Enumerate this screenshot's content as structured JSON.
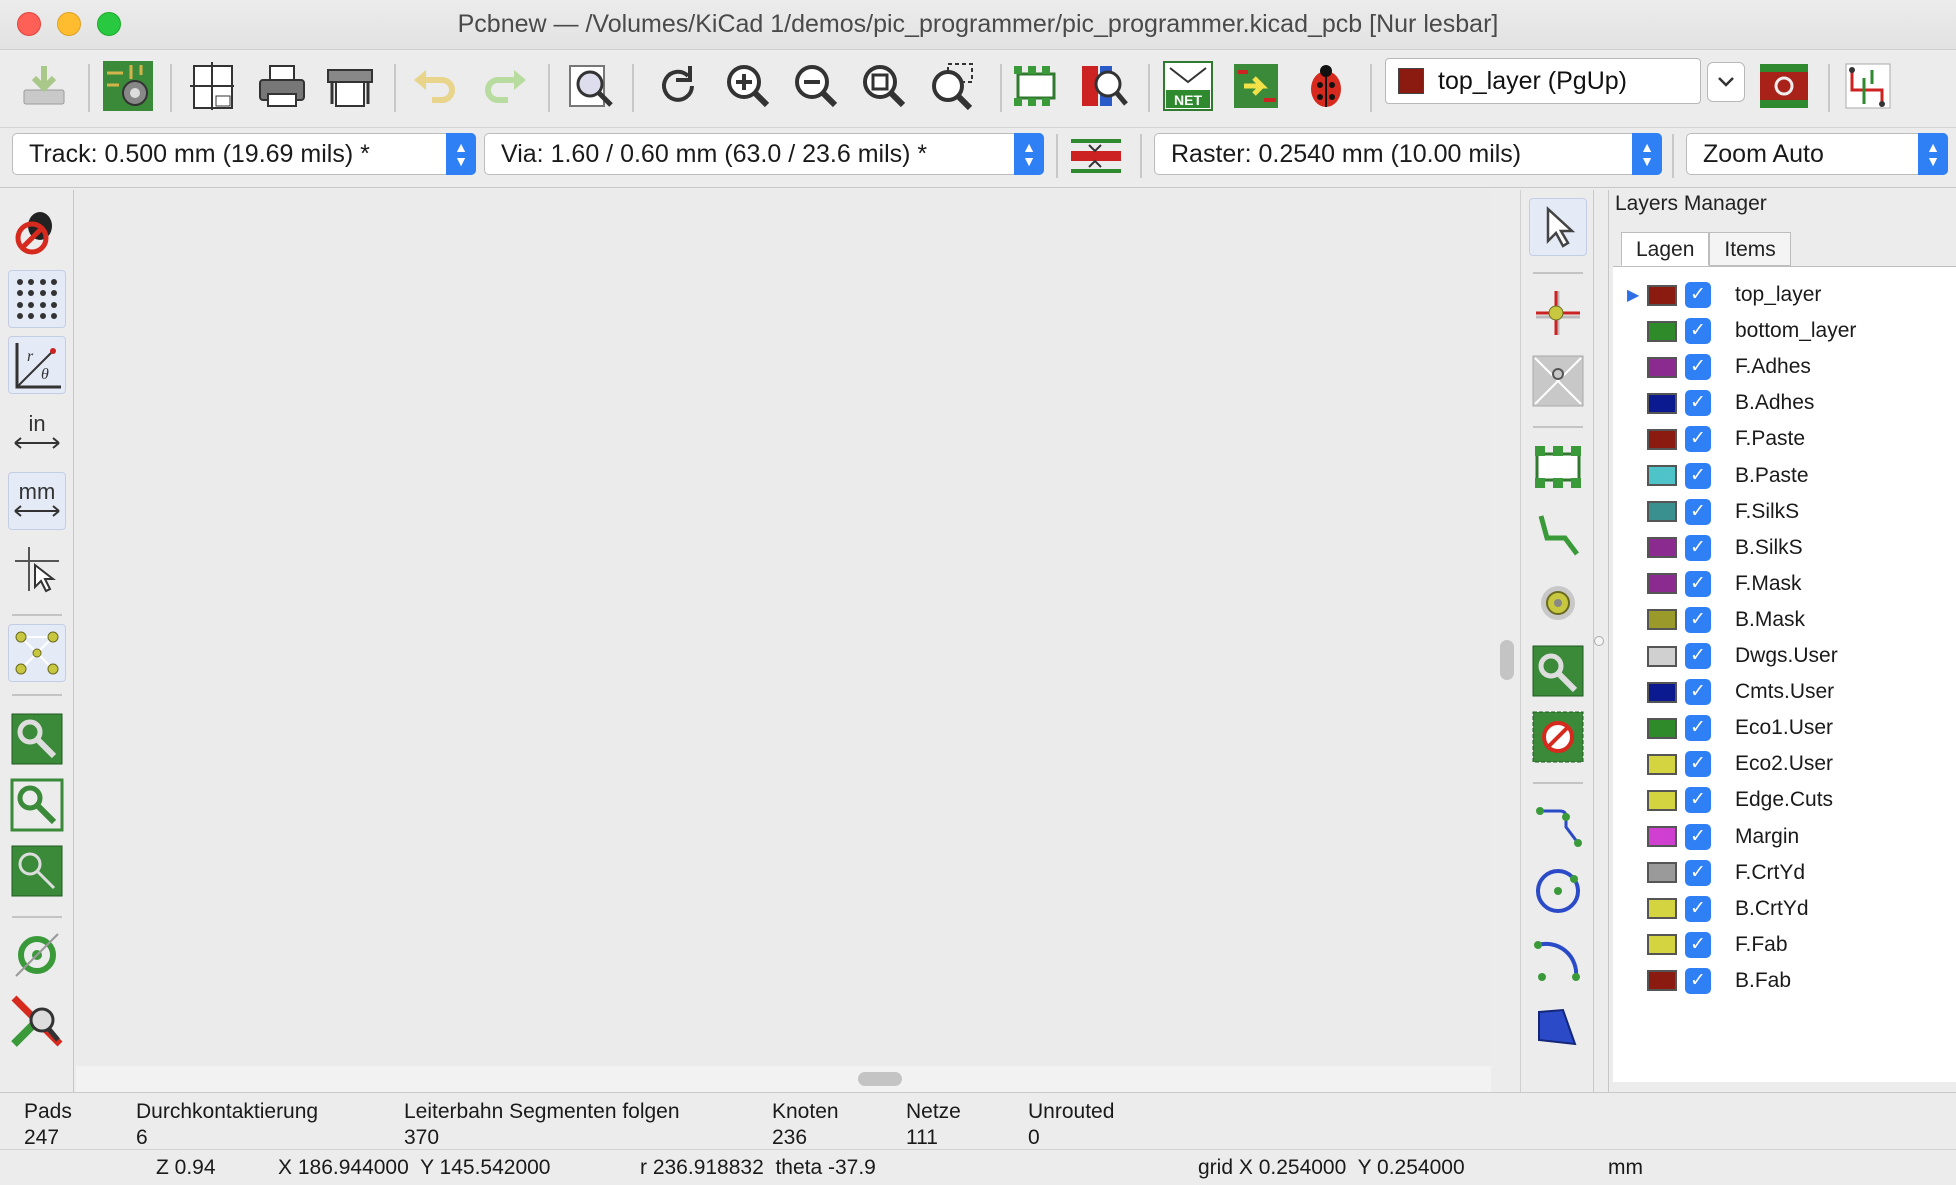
{
  "window": {
    "title": "Pcbnew — /Volumes/KiCad 1/demos/pic_programmer/pic_programmer.kicad_pcb [Nur lesbar]"
  },
  "toolbar": {
    "layer_select": "top_layer (PgUp)",
    "layer_color": "#8b1a10",
    "icons": [
      "save-icon",
      "board-setup-icon",
      "page-settings-icon",
      "print-icon",
      "plot-icon",
      "undo-icon",
      "redo-icon",
      "find-icon",
      "redraw-icon",
      "zoom-in-icon",
      "zoom-out-icon",
      "zoom-fit-icon",
      "zoom-selection-icon",
      "footprint-editor-icon",
      "footprint-browser-icon",
      "netlist-icon",
      "update-pcb-icon",
      "drc-icon",
      "layer-pair-icon",
      "microwave-icon"
    ]
  },
  "toolbar2": {
    "track": "Track: 0.500 mm (19.69 mils) *",
    "via": "Via: 1.60 / 0.60 mm (63.0 / 23.6 mils) *",
    "raster": "Raster: 0.2540 mm (10.00 mils)",
    "zoom": "Zoom Auto"
  },
  "left_toolbar": {
    "icons": [
      "drc-off-icon",
      "grid-icon",
      "polar-coords-icon",
      "inches-icon",
      "millimeters-icon",
      "full-crosshair-icon",
      "ratsnest-icon",
      "zone-fill-icon",
      "zone-unfill-icon",
      "zone-outline-icon",
      "pad-sketch-icon",
      "high-contrast-icon"
    ]
  },
  "right_toolbar": {
    "icons": [
      "select-icon",
      "highlight-net-icon",
      "local-ratsnest-icon",
      "add-footprint-icon",
      "route-track-icon",
      "add-via-icon",
      "add-zone-icon",
      "keepout-icon",
      "add-line-icon",
      "add-circle-icon",
      "add-arc-icon",
      "add-polygon-icon"
    ]
  },
  "layers_manager": {
    "title": "Layers Manager",
    "tabs": [
      "Lagen",
      "Items"
    ],
    "layers": [
      {
        "name": "top_layer",
        "color": "#8b1a10"
      },
      {
        "name": "bottom_layer",
        "color": "#2f8a2a"
      },
      {
        "name": "F.Adhes",
        "color": "#8b2a8f"
      },
      {
        "name": "B.Adhes",
        "color": "#0c1a8f"
      },
      {
        "name": "F.Paste",
        "color": "#8b1a10"
      },
      {
        "name": "B.Paste",
        "color": "#4fc4c8"
      },
      {
        "name": "F.SilkS",
        "color": "#3a8f8f"
      },
      {
        "name": "B.SilkS",
        "color": "#8b2a8f"
      },
      {
        "name": "F.Mask",
        "color": "#8b2a8f"
      },
      {
        "name": "B.Mask",
        "color": "#9a9a2a"
      },
      {
        "name": "Dwgs.User",
        "color": "#d0d0d0"
      },
      {
        "name": "Cmts.User",
        "color": "#0c1a8f"
      },
      {
        "name": "Eco1.User",
        "color": "#2f8a2a"
      },
      {
        "name": "Eco2.User",
        "color": "#d4d440"
      },
      {
        "name": "Edge.Cuts",
        "color": "#d4d440"
      },
      {
        "name": "Margin",
        "color": "#d040d0"
      },
      {
        "name": "F.CrtYd",
        "color": "#9a9a9a"
      },
      {
        "name": "B.CrtYd",
        "color": "#d4d440"
      },
      {
        "name": "F.Fab",
        "color": "#d4d440"
      },
      {
        "name": "B.Fab",
        "color": "#8b1a10"
      }
    ]
  },
  "status": {
    "pads_label": "Pads",
    "pads_value": "247",
    "vias_label": "Durchkontaktierung",
    "vias_value": "6",
    "segments_label": "Leiterbahn Segmenten folgen",
    "segments_value": "370",
    "nodes_label": "Knoten",
    "nodes_value": "236",
    "nets_label": "Netze",
    "nets_value": "111",
    "unrouted_label": "Unrouted",
    "unrouted_value": "0",
    "zoom": "Z 0.94",
    "xy": "X 186.944000  Y 145.542000",
    "polar": "r 236.918832  theta -37.9",
    "grid": "grid X 0.254000  Y 0.254000",
    "units": "mm"
  }
}
